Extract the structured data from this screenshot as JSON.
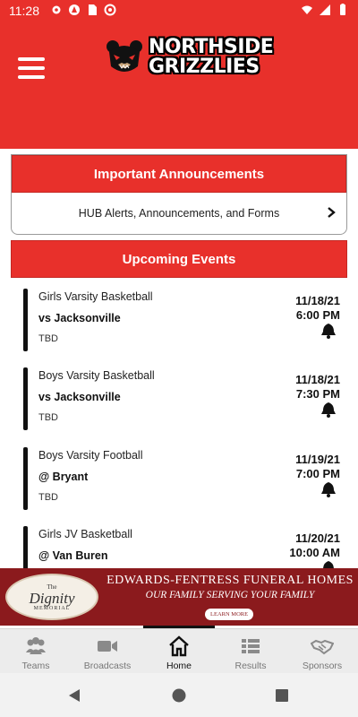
{
  "status_bar": {
    "time": "11:28"
  },
  "header": {
    "logo_line1": "NORTHSIDE",
    "logo_line2": "GRIZZLIES"
  },
  "announcements": {
    "title": "Important Announcements",
    "row_label": "HUB Alerts, Announcements, and Forms"
  },
  "events_section": {
    "title": "Upcoming Events"
  },
  "events": [
    {
      "sport": "Girls Varsity Basketball",
      "opponent": "vs Jacksonville",
      "location": "TBD",
      "date": "11/18/21",
      "time": "6:00 PM"
    },
    {
      "sport": "Boys Varsity Basketball",
      "opponent": "vs Jacksonville",
      "location": "TBD",
      "date": "11/18/21",
      "time": "7:30 PM"
    },
    {
      "sport": "Boys Varsity Football",
      "opponent": "@ Bryant",
      "location": "TBD",
      "date": "11/19/21",
      "time": "7:00 PM"
    },
    {
      "sport": "Girls JV Basketball",
      "opponent": "@ Van Buren",
      "location": "",
      "date": "11/20/21",
      "time": "10:00 AM"
    }
  ],
  "ad": {
    "logo_the": "The",
    "logo_main": "Dignity",
    "logo_sub": "MEMORIAL",
    "title": "EDWARDS-FENTRESS FUNERAL HOMES",
    "tagline": "OUR FAMILY SERVING YOUR FAMILY",
    "cta": "LEARN MORE"
  },
  "bottom_nav": [
    {
      "label": "Teams",
      "icon": "teams-icon"
    },
    {
      "label": "Broadcasts",
      "icon": "video-camera-icon"
    },
    {
      "label": "Home",
      "icon": "home-icon"
    },
    {
      "label": "Results",
      "icon": "list-icon"
    },
    {
      "label": "Sponsors",
      "icon": "handshake-icon"
    }
  ],
  "colors": {
    "brand_red": "#e8302b",
    "ad_maroon": "#8b1a1d",
    "nav_bg": "#ececec"
  }
}
